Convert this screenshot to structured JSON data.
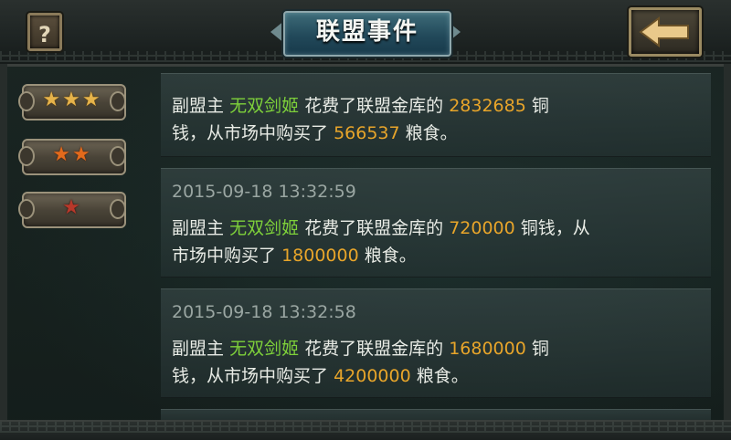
{
  "header": {
    "title": "联盟事件",
    "help_label": "?"
  },
  "sidebar": {
    "tabs": [
      {
        "stars": "★★★",
        "color": "gold"
      },
      {
        "stars": "★★",
        "color": "orange"
      },
      {
        "stars": "★",
        "color": "red"
      }
    ]
  },
  "events": [
    {
      "time": "",
      "role": "副盟主",
      "name": "无双剑姬",
      "text1": "花费了联盟金库的",
      "amount": "2832685",
      "text2": "铜",
      "text3": "钱，从市场中购买了",
      "food": "566537",
      "text4": "粮食。"
    },
    {
      "time": "2015-09-18 13:32:59",
      "role": "副盟主",
      "name": "无双剑姬",
      "text1": "花费了联盟金库的",
      "amount": "720000",
      "text2": "铜钱，从",
      "text3": "市场中购买了",
      "food": "1800000",
      "text4": "粮食。"
    },
    {
      "time": "2015-09-18 13:32:58",
      "role": "副盟主",
      "name": "无双剑姬",
      "text1": "花费了联盟金库的",
      "amount": "1680000",
      "text2": "铜",
      "text3": "钱，从市场中购买了",
      "food": "4200000",
      "text4": "粮食。"
    }
  ],
  "colors": {
    "name_highlight": "#7ed13a",
    "number_highlight": "#e8a52a",
    "text": "#e9ece6",
    "timestamp": "#9aa6a2"
  }
}
